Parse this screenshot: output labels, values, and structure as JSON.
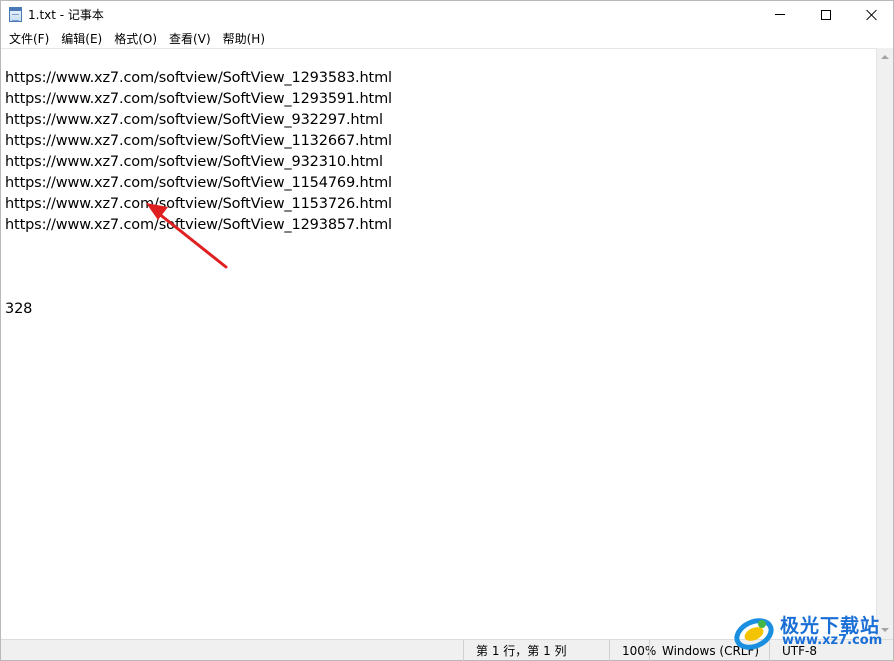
{
  "window": {
    "title": "1.txt - 记事本",
    "icon": "notepad-icon"
  },
  "menu": {
    "items": [
      {
        "label": "文件(F)"
      },
      {
        "label": "编辑(E)"
      },
      {
        "label": "格式(O)"
      },
      {
        "label": "查看(V)"
      },
      {
        "label": "帮助(H)"
      }
    ]
  },
  "editor": {
    "lines": [
      "",
      "https://www.xz7.com/softview/SoftView_1293583.html",
      "https://www.xz7.com/softview/SoftView_1293591.html",
      "https://www.xz7.com/softview/SoftView_932297.html",
      "https://www.xz7.com/softview/SoftView_1132667.html",
      "https://www.xz7.com/softview/SoftView_932310.html",
      "https://www.xz7.com/softview/SoftView_1154769.html",
      "https://www.xz7.com/softview/SoftView_1153726.html",
      "https://www.xz7.com/softview/SoftView_1293857.html",
      "",
      "",
      "",
      "328"
    ]
  },
  "status": {
    "position": "第 1 行，第 1 列",
    "zoom": "100%",
    "line_ending": "Windows (CRLF)",
    "encoding": "UTF-8"
  },
  "annotation": {
    "color": "#e02020",
    "icon": "red-arrow-icon"
  },
  "watermark": {
    "text": "极光下载站",
    "url": "www.xz7.com"
  }
}
